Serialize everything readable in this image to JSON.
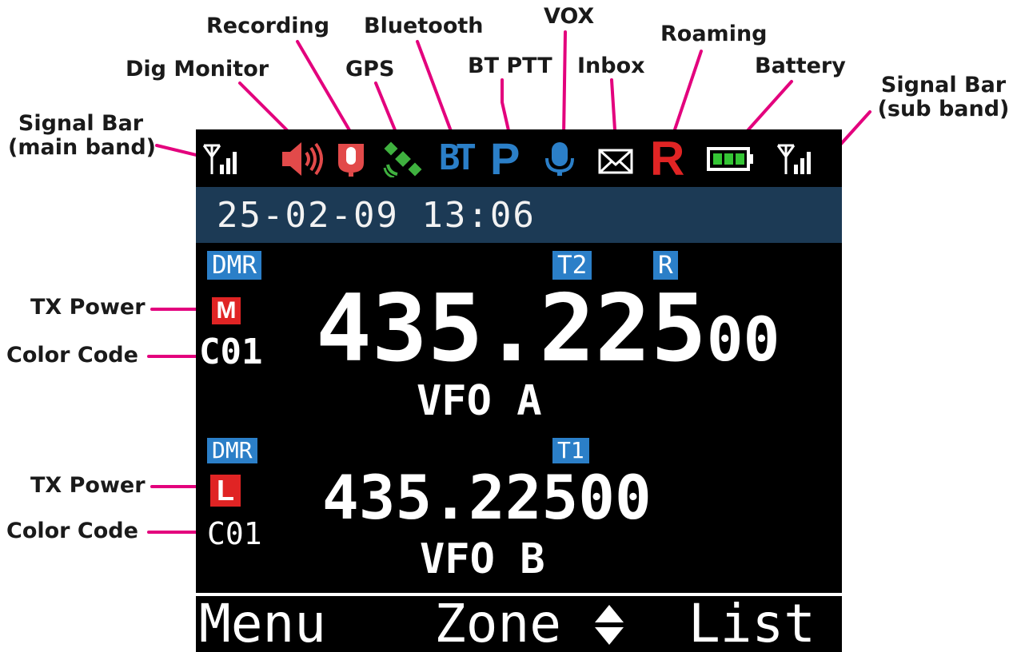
{
  "callouts": {
    "signal_main_line1": "Signal Bar",
    "signal_main_line2": "(main band)",
    "dig_monitor": "Dig Monitor",
    "recording": "Recording",
    "gps": "GPS",
    "bluetooth": "Bluetooth",
    "bt_ptt": "BT PTT",
    "vox": "VOX",
    "inbox": "Inbox",
    "roaming": "Roaming",
    "battery": "Battery",
    "signal_sub_line1": "Signal Bar",
    "signal_sub_line2": "(sub band)",
    "tx_power_a": "TX Power",
    "color_code_a": "Color Code",
    "tx_power_b": "TX Power",
    "color_code_b": "Color Code"
  },
  "status_icons": {
    "names": [
      "signal-bar-icon",
      "speaker-icon",
      "microphone-icon",
      "gps-icon",
      "bluetooth-icon",
      "bt-ptt-icon",
      "vox-icon",
      "envelope-icon",
      "roaming-icon",
      "battery-icon",
      "signal-bar-icon"
    ],
    "bt_text": "BT",
    "ptt_text": "P",
    "roaming_text": "R"
  },
  "colors": {
    "screen_bg": "#000000",
    "date_bar": "#1c3a55",
    "tag_blue": "#2b7fc8",
    "power_red": "#e02424",
    "callout_line": "#e3007d",
    "gps_green": "#3fb13f",
    "record_red": "#e24a4a",
    "battery_green": "#35c535"
  },
  "datetime": "25-02-09 13:06",
  "vfo_a": {
    "mode": "DMR",
    "timeslot": "T2",
    "roaming": "R",
    "power": "M",
    "color_code": "C01",
    "freq_main": "435.225",
    "freq_sub": "00",
    "name": "VFO A"
  },
  "vfo_b": {
    "mode": "DMR",
    "timeslot": "T1",
    "power": "L",
    "color_code": "C01",
    "freq": "435.22500",
    "name": "VFO B"
  },
  "softkeys": {
    "left": "Menu",
    "center": "Zone",
    "center_icon": "up-down-arrow-icon",
    "right": "List"
  }
}
